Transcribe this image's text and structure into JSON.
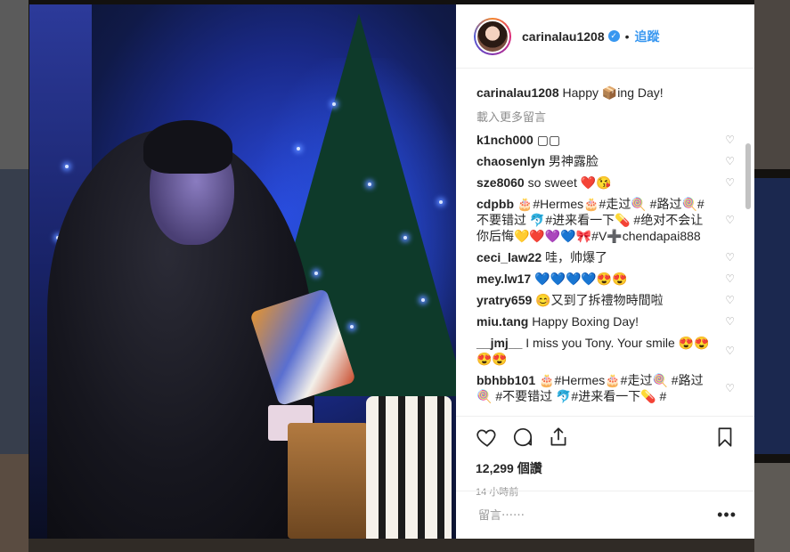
{
  "post": {
    "username": "carinalau1208",
    "verified_icon": "verified-badge-icon",
    "separator": "•",
    "follow_label": "追蹤",
    "caption_text": "Happy 📦ing Day!",
    "load_more_label": "載入更多留言"
  },
  "comments": [
    {
      "user": "k1nch000",
      "text": "▢▢"
    },
    {
      "user": "chaosenlyn",
      "text": "男神露脸"
    },
    {
      "user": "sze8060",
      "text": "so sweet ❤️😘"
    },
    {
      "user": "cdpbb",
      "text": "🎂#Hermes🎂#走过🍭 #路过🍭#不要错过 🐬#进来看一下💊 #绝对不会让你后悔💛❤️💜💙🎀#V➕chendapai888"
    },
    {
      "user": "ceci_law22",
      "text": "哇，帅爆了"
    },
    {
      "user": "mey.lw17",
      "text": "💙💙💙💙😍😍"
    },
    {
      "user": "yratry659",
      "text": "😊又到了拆禮物時間啦"
    },
    {
      "user": "miu.tang",
      "text": "Happy Boxing Day!"
    },
    {
      "user": "__jmj__",
      "text": "I miss you Tony. Your smile 😍😍😍😍"
    },
    {
      "user": "bbhbb101",
      "text": "🎂#Hermes🎂#走过🍭 #路过🍭 #不要错过 🐬#进来看一下💊 #"
    }
  ],
  "actions": {
    "likes_count": "12,299 個讚",
    "timestamp": "14 小時前",
    "comment_placeholder": "留言⋯⋯",
    "more_label": "•••"
  },
  "colors": {
    "accent": "#3897f0",
    "text": "#262626",
    "muted": "#999999"
  }
}
